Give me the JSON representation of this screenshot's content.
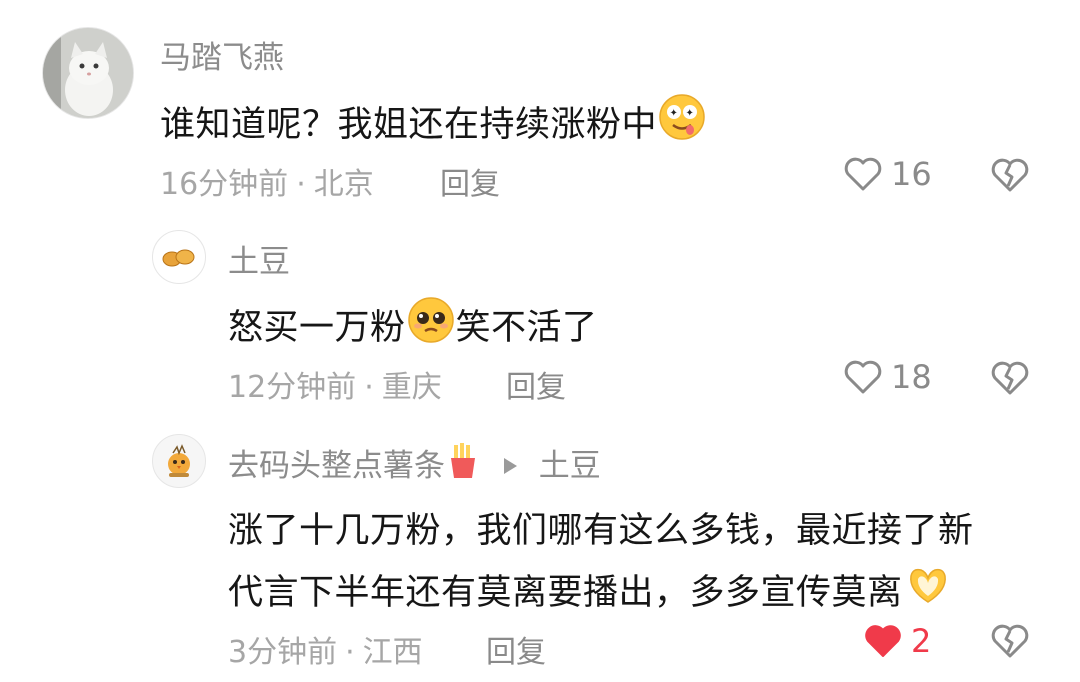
{
  "comments": [
    {
      "username": "马踏飞燕",
      "text": "谁知道呢？我姐还在持续涨粉中",
      "time": "16分钟前",
      "location": "北京",
      "reply_label": "回复",
      "likes": "16",
      "liked": false
    },
    {
      "username": "土豆",
      "text_before": "怒买一万粉",
      "text_after": "笑不活了",
      "time": "12分钟前",
      "location": "重庆",
      "reply_label": "回复",
      "likes": "18",
      "liked": false
    },
    {
      "username": "去码头整点薯条",
      "reply_to": "土豆",
      "line1": "涨了十几万粉，我们哪有这么多钱，最近接了新",
      "line2": "代言下半年还有莫离要播出，多多宣传莫离",
      "time": "3分钟前",
      "location": "江西",
      "reply_label": "回复",
      "likes": "2",
      "liked": true
    }
  ],
  "separator": "·",
  "icons": {
    "like": "heart-outline-icon",
    "liked": "heart-filled-icon",
    "dislike": "broken-heart-icon",
    "reply_arrow": "triangle-right-icon"
  },
  "colors": {
    "liked_red": "#f03a4a",
    "muted": "#a6a6a6",
    "text": "#161616"
  }
}
